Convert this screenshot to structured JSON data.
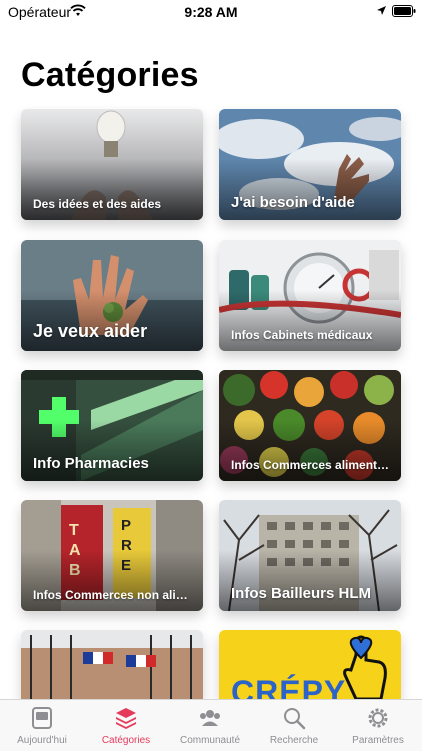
{
  "status_bar": {
    "carrier": "Opérateur",
    "time": "9:28 AM"
  },
  "page": {
    "title": "Catégories"
  },
  "categories": [
    {
      "label": "Des idées et des aides"
    },
    {
      "label": "J'ai besoin d'aide"
    },
    {
      "label": "Je veux aider"
    },
    {
      "label": "Infos Cabinets médicaux"
    },
    {
      "label": "Info Pharmacies"
    },
    {
      "label": "Infos Commerces alimentaires"
    },
    {
      "label": "Infos Commerces non alimentaires"
    },
    {
      "label": "Infos Bailleurs HLM"
    },
    {
      "label": ""
    },
    {
      "label": ""
    }
  ],
  "banner_text": "CRÉPY",
  "tabs": [
    {
      "label": "Aujourd'hui",
      "icon": "newspaper-icon"
    },
    {
      "label": "Catégories",
      "icon": "layers-icon",
      "active": true
    },
    {
      "label": "Communauté",
      "icon": "people-icon"
    },
    {
      "label": "Recherche",
      "icon": "search-icon"
    },
    {
      "label": "Paramètres",
      "icon": "gear-icon"
    }
  ],
  "colors": {
    "accent": "#e63a5a",
    "tab_inactive": "#8e8e93",
    "banner_yellow": "#f6d21a"
  }
}
